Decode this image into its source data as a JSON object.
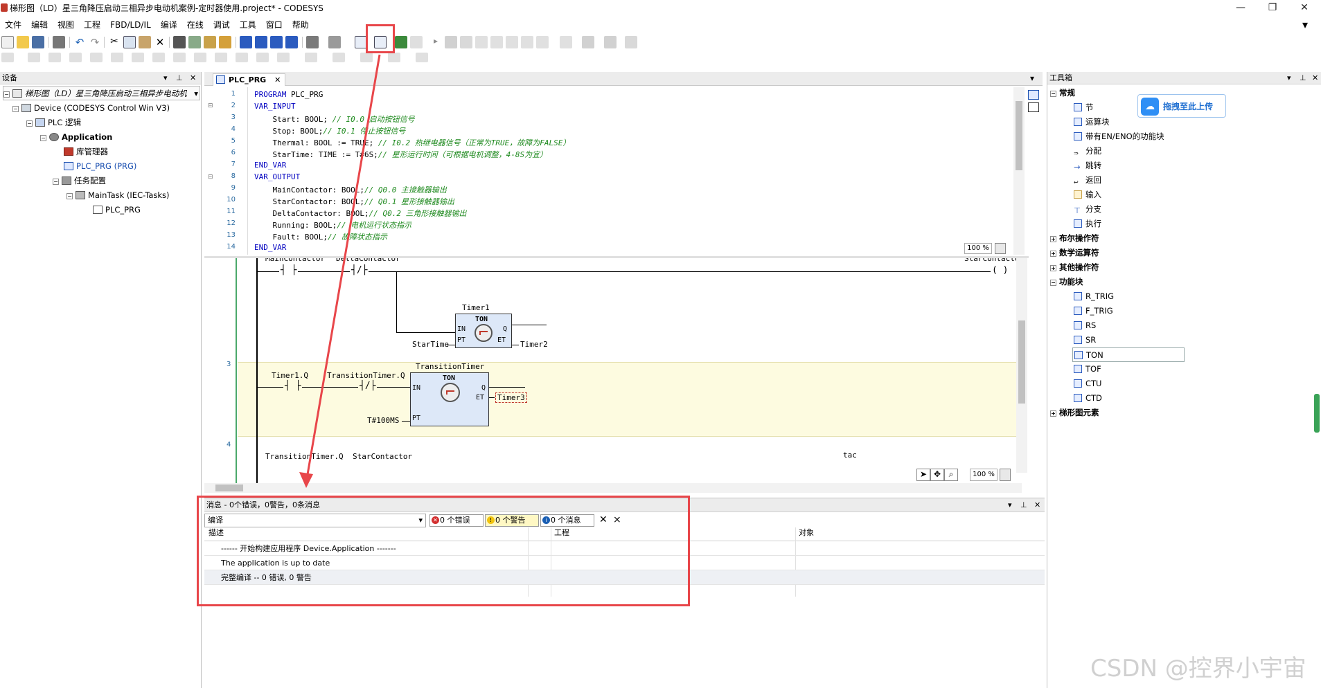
{
  "window": {
    "title": "梯形图（LD）星三角降压启动三相异步电动机案例-定时器使用.project* - CODESYS",
    "controls": {
      "minimize": "—",
      "maximize": "❐",
      "close": "✕"
    }
  },
  "menu": [
    "文件",
    "编辑",
    "视图",
    "工程",
    "FBD/LD/IL",
    "编译",
    "在线",
    "调试",
    "工具",
    "窗口",
    "帮助"
  ],
  "devices_panel": {
    "title": "设备",
    "dropdown": "梯形图（LD）星三角降压启动三相异步电动机",
    "tree": [
      "梯形图（LD）星三角降压启动三相异步电动机",
      "Device (CODESYS Control Win V3)",
      "PLC 逻辑",
      "Application",
      "库管理器",
      "PLC_PRG (PRG)",
      "任务配置",
      "MainTask (IEC-Tasks)",
      "PLC_PRG"
    ]
  },
  "editor": {
    "tab": "PLC_PRG",
    "zoom_top": "100 %",
    "zoom_bottom": "100 %",
    "line_numbers": [
      "1",
      "2",
      "3",
      "4",
      "5",
      "6",
      "7",
      "8",
      "9",
      "10",
      "11",
      "12",
      "13",
      "14"
    ],
    "lines": [
      {
        "kw": "PROGRAM",
        "rest": " PLC_PRG"
      },
      {
        "kw": "VAR_INPUT",
        "rest": ""
      },
      {
        "code": "    Start: BOOL; ",
        "comment": "// I0.0 启动按钮信号"
      },
      {
        "code": "    Stop: BOOL;",
        "comment": "// I0.1 停止按钮信号"
      },
      {
        "code": "    Thermal: BOOL := TRUE; ",
        "comment": "// I0.2 热继电器信号（正常为TRUE，故障为FALSE）"
      },
      {
        "code": "    StarTime: TIME := T#6S;",
        "comment": "// 星形运行时间（可根据电机调整，4-8S为宜）"
      },
      {
        "kw": "END_VAR",
        "rest": ""
      },
      {
        "kw": "VAR_OUTPUT",
        "rest": ""
      },
      {
        "code": "    MainContactor: BOOL;",
        "comment": "// Q0.0 主接触器输出"
      },
      {
        "code": "    StarContactor: BOOL;",
        "comment": "// Q0.1 星形接触器输出"
      },
      {
        "code": "    DeltaContactor: BOOL;",
        "comment": "// Q0.2 三角形接触器输出"
      },
      {
        "code": "    Running: BOOL;",
        "comment": "// 电机运行状态指示"
      },
      {
        "code": "    Fault: BOOL;",
        "comment": "// 故障状态指示"
      },
      {
        "kw": "END_VAR",
        "rest": ""
      }
    ],
    "ld": {
      "rung3_num": "3",
      "rung4_num": "4",
      "top_contacts": [
        "MainContactor",
        "DeltaContactor"
      ],
      "top_coil": "StarContactor",
      "timer1": {
        "instance": "Timer1",
        "type": "TON",
        "in": "IN",
        "pt": "PT",
        "q": "Q",
        "et": "ET",
        "pt_var": "StarTime",
        "et_var": "Timer2"
      },
      "transition": {
        "instance": "TransitionTimer",
        "type": "TON",
        "in": "IN",
        "pt": "PT",
        "q": "Q",
        "et": "ET",
        "pt_var": "T#100MS",
        "et_var": "Timer3"
      },
      "rung3_contacts": [
        "Timer1.Q",
        "TransitionTimer.Q"
      ],
      "rung4_contacts": [
        "TransitionTimer.Q",
        "StarContactor"
      ],
      "cut_text": "tac"
    }
  },
  "messages": {
    "title": "消息 - 0个错误，0警告，0条消息",
    "category": "编译",
    "errors": "0 个错误",
    "warnings": "0 个警告",
    "infos": "0 个消息",
    "columns": [
      "描述",
      "工程",
      "对象"
    ],
    "rows": [
      "------ 开始构建应用程序 Device.Application -------",
      "The application is up to date",
      "完整编译 -- 0 错误, 0 警告"
    ]
  },
  "toolbox": {
    "title": "工具箱",
    "upload_badge": "拖拽至此上传",
    "groups": [
      {
        "label": "常规",
        "expanded": true
      },
      {
        "label": "布尔操作符",
        "expanded": false
      },
      {
        "label": "数学运算符",
        "expanded": false
      },
      {
        "label": "其他操作符",
        "expanded": false
      },
      {
        "label": "功能块",
        "expanded": true
      },
      {
        "label": "梯形图元素",
        "expanded": false
      }
    ],
    "general_items": [
      "节",
      "运算块",
      "带有EN/ENO的功能块",
      "分配",
      "跳转",
      "返回",
      "输入",
      "分支",
      "执行"
    ],
    "fb_items": [
      "R_TRIG",
      "F_TRIG",
      "RS",
      "SR",
      "TON",
      "TOF",
      "CTU",
      "CTD"
    ],
    "selected_fb": "TON"
  },
  "watermark": "CSDN @控界小宇宙",
  "colors": {
    "annotation_red": "#e8464a",
    "keyword_blue": "#0000c0",
    "comment_green": "#1f8a1f",
    "rung_highlight": "#fdfbe0",
    "fb_fill": "#dde8f8"
  }
}
